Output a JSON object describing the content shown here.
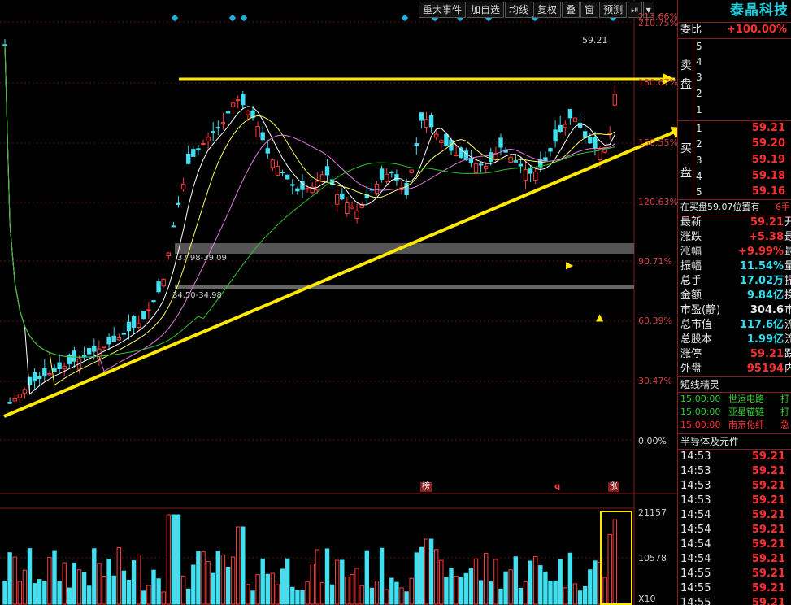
{
  "toolbar": {
    "items": [
      "重大事件",
      "加自选",
      "均线",
      "复权",
      "叠",
      "窗",
      "预测"
    ],
    "icon1": "⏯",
    "icon2": "▾"
  },
  "price_axis": {
    "labels": [
      "213.66%",
      "210.75%",
      "180.67%",
      "150.55%",
      "120.63%",
      "90.71%",
      "60.39%",
      "30.47%",
      "0.00%"
    ]
  },
  "volume_axis": {
    "labels": [
      "21157",
      "10578",
      "X10"
    ]
  },
  "chart_annotations": {
    "high_price": "59.21",
    "band1": "37.98-39.09",
    "band2": "34.50-34.98",
    "mark_bang": "榜",
    "mark_q": "q",
    "mark_zhang": "涨"
  },
  "side": {
    "stock_name": "泰晶科技",
    "wei_label": "委比",
    "wei_value": "+100.00%",
    "sell_label_1": "卖",
    "sell_label_2": "盘",
    "sell_levels": [
      "5",
      "4",
      "3",
      "2",
      "1"
    ],
    "buy_label_1": "买",
    "buy_label_2": "盘",
    "buy_levels": [
      {
        "n": "1",
        "p": "59.21"
      },
      {
        "n": "2",
        "p": "59.20"
      },
      {
        "n": "3",
        "p": "59.19"
      },
      {
        "n": "4",
        "p": "59.18"
      },
      {
        "n": "5",
        "p": "59.16"
      }
    ],
    "position_note": "在买盘59.07位置有",
    "position_qty": "6手",
    "stats": [
      {
        "label": "最新",
        "value": "59.21",
        "color": "red",
        "tail": "开"
      },
      {
        "label": "涨跌",
        "value": "+5.38",
        "color": "red",
        "tail": "最"
      },
      {
        "label": "涨幅",
        "value": "+9.99%",
        "color": "red",
        "tail": "最"
      },
      {
        "label": "振幅",
        "value": "11.54%",
        "color": "cyan",
        "tail": "量"
      },
      {
        "label": "总手",
        "value": "17.02万",
        "color": "cyan",
        "tail": "振"
      },
      {
        "label": "金额",
        "value": "9.84亿",
        "color": "cyan",
        "tail": "换"
      },
      {
        "label": "市盈(静)",
        "value": "304.6",
        "color": "white",
        "tail": "市"
      },
      {
        "label": "总市值",
        "value": "117.6亿",
        "color": "cyan",
        "tail": "流"
      },
      {
        "label": "总股本",
        "value": "1.99亿",
        "color": "cyan",
        "tail": "流"
      },
      {
        "label": "涨停",
        "value": "59.21",
        "color": "red",
        "tail": "跌"
      },
      {
        "label": "外盘",
        "value": "95194",
        "color": "red",
        "tail": "内"
      }
    ],
    "sprite_title": "短线精灵",
    "sprite_rows": [
      {
        "time": "15:00:00",
        "name": "世运电路",
        "tag": "打"
      },
      {
        "time": "15:00:00",
        "name": "亚星锚链",
        "tag": "打"
      },
      {
        "time": "15:00:00",
        "name": "南京化纤",
        "tag": "急"
      }
    ],
    "sector_title": "半导体及元件",
    "ticks": [
      {
        "t": "14:53",
        "p": "59.21"
      },
      {
        "t": "14:53",
        "p": "59.21"
      },
      {
        "t": "14:53",
        "p": "59.21"
      },
      {
        "t": "14:53",
        "p": "59.21"
      },
      {
        "t": "14:54",
        "p": "59.21"
      },
      {
        "t": "14:54",
        "p": "59.21"
      },
      {
        "t": "14:54",
        "p": "59.21"
      },
      {
        "t": "14:54",
        "p": "59.21"
      },
      {
        "t": "14:55",
        "p": "59.21"
      },
      {
        "t": "14:55",
        "p": "59.21"
      },
      {
        "t": "14:55",
        "p": "59.21"
      }
    ]
  }
}
